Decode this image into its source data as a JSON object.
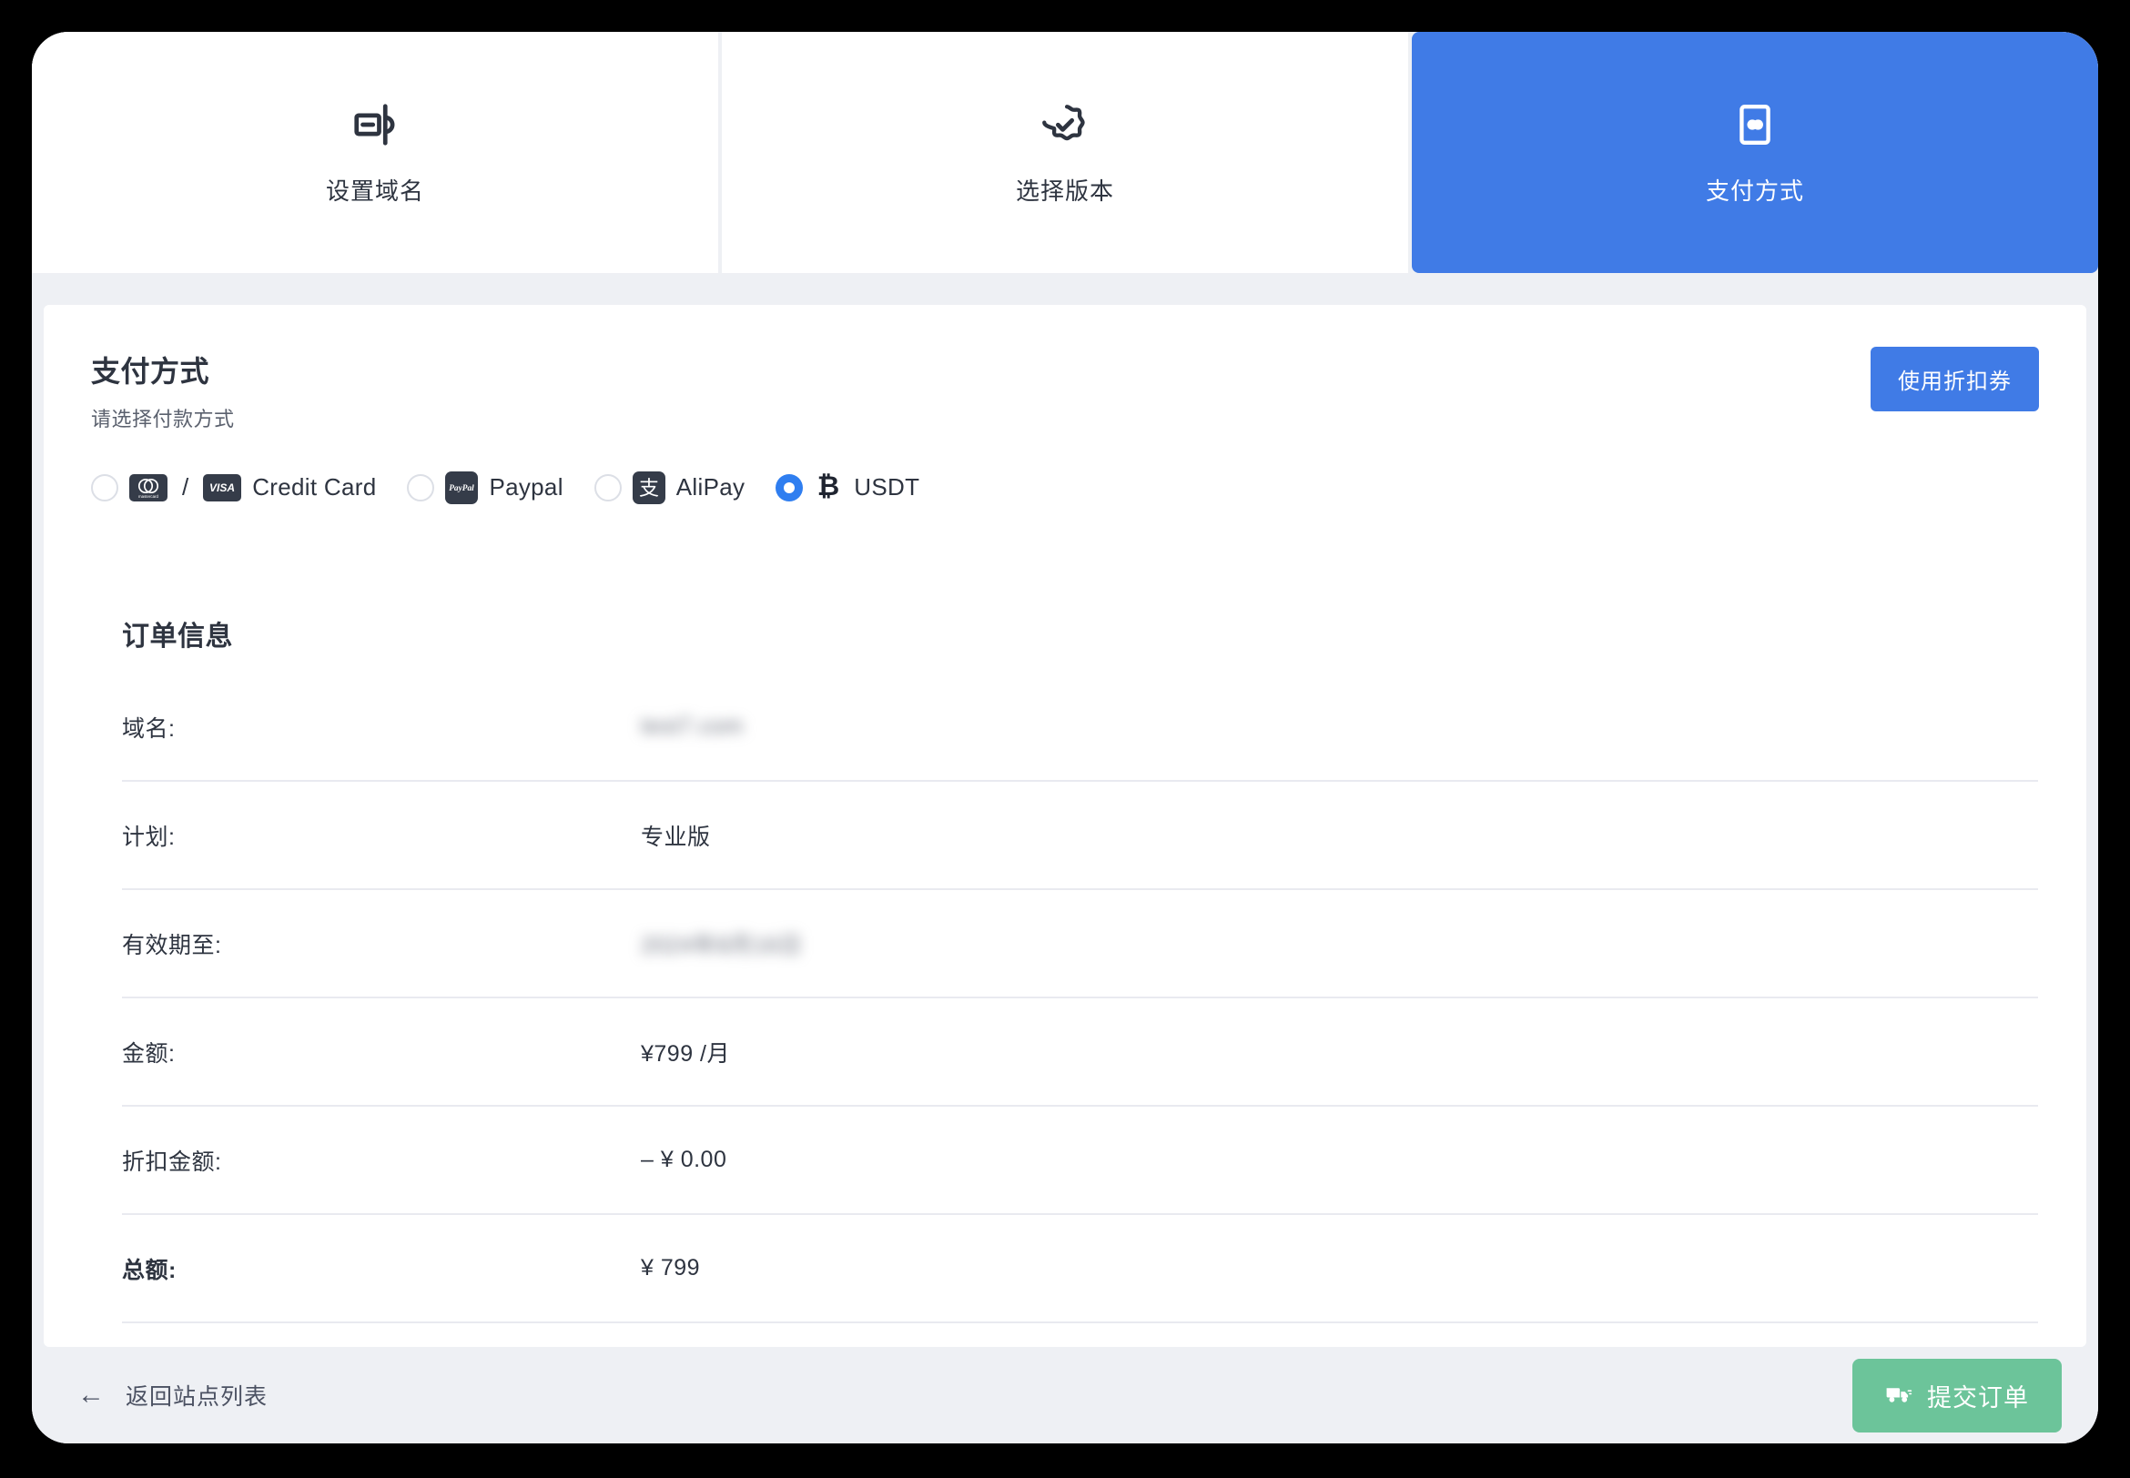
{
  "steps": [
    {
      "label": "设置域名",
      "icon": "domain-setup-icon",
      "active": false
    },
    {
      "label": "选择版本",
      "icon": "badge-check-icon",
      "active": false
    },
    {
      "label": "支付方式",
      "icon": "payment-card-icon",
      "active": true
    }
  ],
  "section": {
    "title": "支付方式",
    "subtitle": "请选择付款方式",
    "coupon_label": "使用折扣券"
  },
  "payment_methods": [
    {
      "id": "credit-card",
      "label": "Credit Card",
      "icons": [
        "mastercard-icon",
        "visa-icon"
      ],
      "separator": "/",
      "selected": false
    },
    {
      "id": "paypal",
      "label": "Paypal",
      "icons": [
        "paypal-icon"
      ],
      "selected": false
    },
    {
      "id": "alipay",
      "label": "AliPay",
      "icons": [
        "alipay-icon"
      ],
      "selected": false
    },
    {
      "id": "usdt",
      "label": "USDT",
      "icons": [
        "bitcoin-icon"
      ],
      "selected": true
    }
  ],
  "order": {
    "title": "订单信息",
    "rows": [
      {
        "label": "域名:",
        "value": "test7.com",
        "redacted": true
      },
      {
        "label": "计划:",
        "value": "专业版",
        "redacted": false
      },
      {
        "label": "有效期至:",
        "value": "2024年8月16日",
        "redacted": true
      },
      {
        "label": "金额:",
        "value": "¥799 /月",
        "redacted": false
      },
      {
        "label": "折扣金额:",
        "value": "– ¥ 0.00",
        "redacted": false
      },
      {
        "label": "总额:",
        "value": "¥ 799",
        "redacted": false,
        "emphasis": true
      }
    ]
  },
  "footer": {
    "back_label": "返回站点列表",
    "back_arrow": "←",
    "submit_label": "提交订单"
  },
  "colors": {
    "accent_blue": "#407be6",
    "radio_blue": "#2f7ef0",
    "submit_green": "#6cc49a",
    "page_background": "#eef0f4",
    "card_background": "#ffffff",
    "text_dark": "#2e3440",
    "divider": "#e9eaf0",
    "badge_dark": "#353c49"
  }
}
